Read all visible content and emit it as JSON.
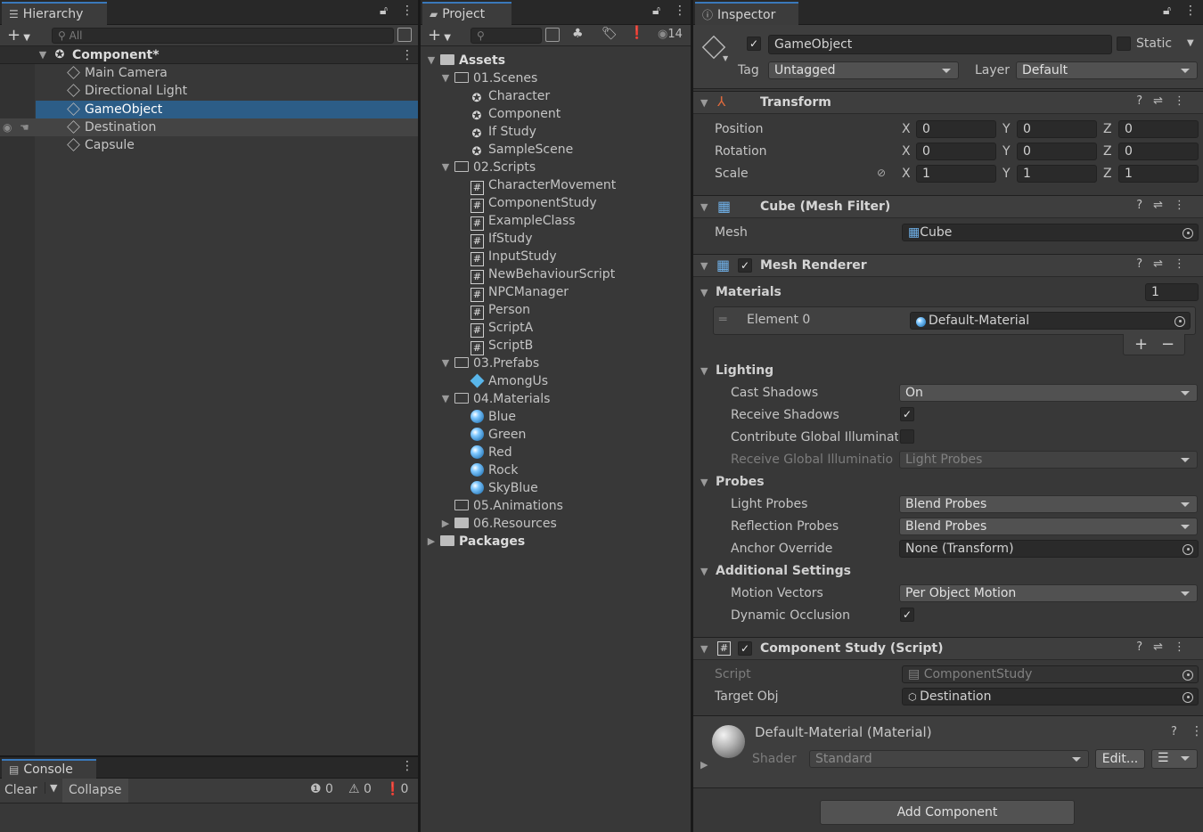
{
  "hierarchy": {
    "tab": "Hierarchy",
    "search_placeholder": "All",
    "scene": "Component*",
    "items": [
      "Main Camera",
      "Directional Light",
      "GameObject",
      "Destination",
      "Capsule"
    ]
  },
  "project": {
    "tab": "Project",
    "hidden_count": "14",
    "root": "Assets",
    "scenes_folder": "01.Scenes",
    "scenes": [
      "Character",
      "Component",
      "If Study",
      "SampleScene"
    ],
    "scripts_folder": "02.Scripts",
    "scripts": [
      "CharacterMovement",
      "ComponentStudy",
      "ExampleClass",
      "IfStudy",
      "InputStudy",
      "NewBehaviourScript",
      "NPCManager",
      "Person",
      "ScriptA",
      "ScriptB"
    ],
    "prefabs_folder": "03.Prefabs",
    "prefabs": [
      "AmongUs"
    ],
    "materials_folder": "04.Materials",
    "materials": [
      "Blue",
      "Green",
      "Red",
      "Rock",
      "SkyBlue"
    ],
    "animations_folder": "05.Animations",
    "resources_folder": "06.Resources",
    "packages": "Packages"
  },
  "console": {
    "tab": "Console",
    "clear": "Clear",
    "collapse": "Collapse",
    "count_info": "0",
    "count_warn": "0",
    "count_error": "0"
  },
  "inspector": {
    "tab": "Inspector",
    "object_name": "GameObject",
    "static_label": "Static",
    "tag_label": "Tag",
    "tag_value": "Untagged",
    "layer_label": "Layer",
    "layer_value": "Default",
    "transform": {
      "title": "Transform",
      "position_label": "Position",
      "rotation_label": "Rotation",
      "scale_label": "Scale",
      "x": "X",
      "y": "Y",
      "z": "Z",
      "position": [
        "0",
        "0",
        "0"
      ],
      "rotation": [
        "0",
        "0",
        "0"
      ],
      "scale": [
        "1",
        "1",
        "1"
      ]
    },
    "mesh_filter": {
      "title": "Cube (Mesh Filter)",
      "mesh_label": "Mesh",
      "mesh_value": "Cube"
    },
    "mesh_renderer": {
      "title": "Mesh Renderer",
      "materials_label": "Materials",
      "materials_count": "1",
      "element_label": "Element 0",
      "element_value": "Default-Material",
      "add": "+",
      "remove": "−",
      "lighting": "Lighting",
      "cast_shadows_label": "Cast Shadows",
      "cast_shadows_value": "On",
      "receive_shadows_label": "Receive Shadows",
      "contribute_gi_label": "Contribute Global Illuminat",
      "receive_gi_label": "Receive Global Illuminatio",
      "receive_gi_value": "Light Probes",
      "probes": "Probes",
      "light_probes_label": "Light Probes",
      "light_probes_value": "Blend Probes",
      "reflection_probes_label": "Reflection Probes",
      "reflection_probes_value": "Blend Probes",
      "anchor_label": "Anchor Override",
      "anchor_value": "None (Transform)",
      "additional": "Additional Settings",
      "motion_vectors_label": "Motion Vectors",
      "motion_vectors_value": "Per Object Motion",
      "dynamic_occlusion_label": "Dynamic Occlusion"
    },
    "script": {
      "title": "Component Study (Script)",
      "script_label": "Script",
      "script_value": "ComponentStudy",
      "target_label": "Target Obj",
      "target_value": "Destination"
    },
    "material": {
      "title": "Default-Material (Material)",
      "shader_label": "Shader",
      "shader_value": "Standard",
      "edit": "Edit..."
    },
    "add_component": "Add Component"
  }
}
